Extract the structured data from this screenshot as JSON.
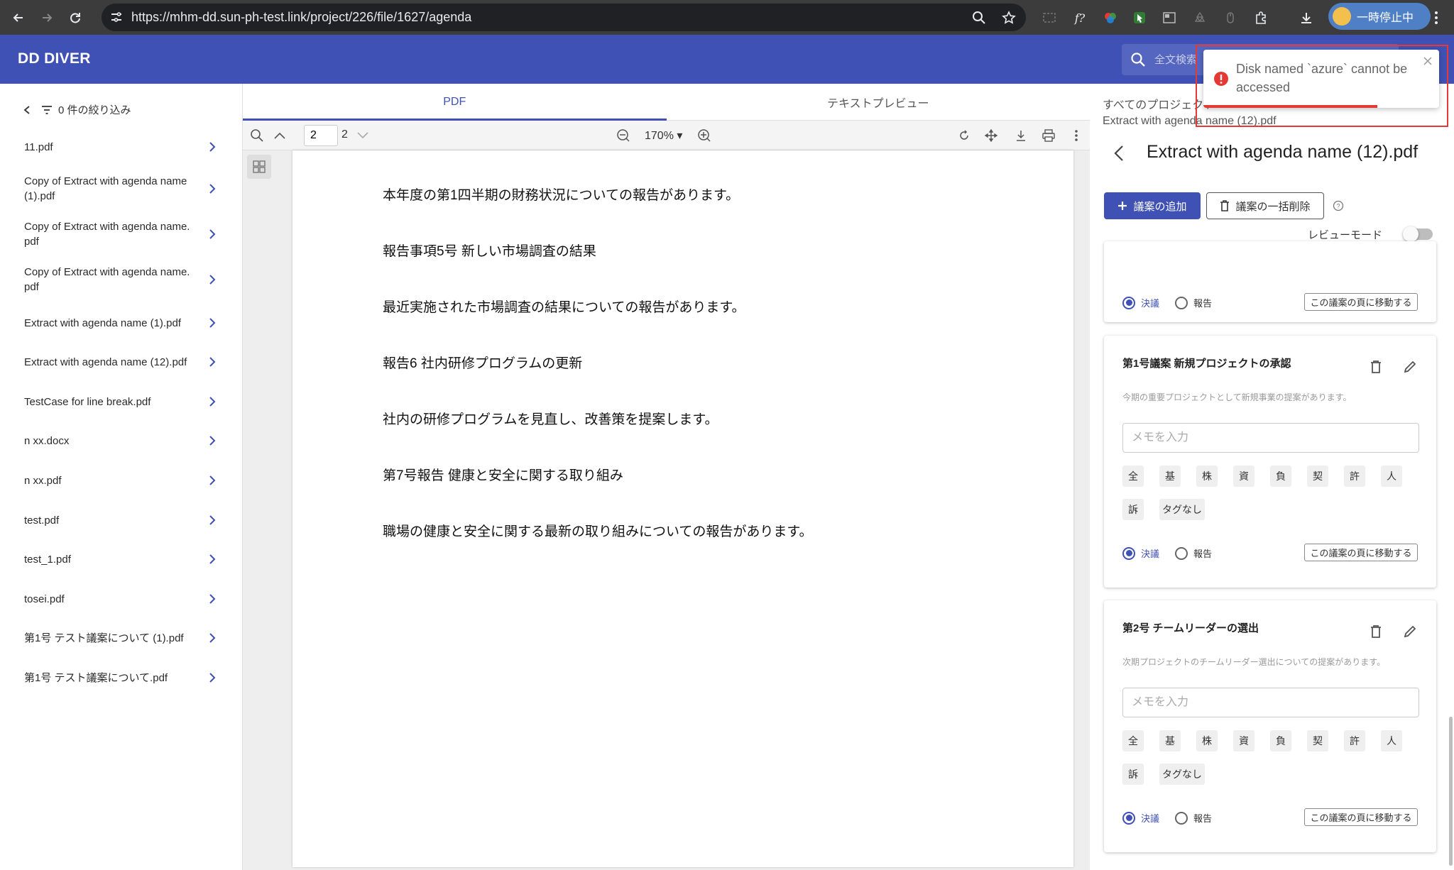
{
  "browser": {
    "url": "https://mhm-dd.sun-ph-test.link/project/226/file/1627/agenda",
    "profile_label": "一時停止中"
  },
  "app": {
    "brand": "DD DIVER",
    "search_placeholder": "全文検索",
    "accent": "#3f51b5"
  },
  "sidebar": {
    "filter_label": "0 件の絞り込み",
    "files": [
      "11.pdf",
      "Copy of Extract with agenda name (1).pdf",
      "Copy of Extract with agenda name.pdf",
      "Copy of Extract with agenda name.pdf",
      "Extract with agenda name (1).pdf",
      "Extract with agenda name (12).pdf",
      "TestCase for line break.pdf",
      "n xx.docx",
      "n xx.pdf",
      "test.pdf",
      "test_1.pdf",
      "tosei.pdf",
      "第1号 テスト議案について (1).pdf",
      "第1号 テスト議案について.pdf"
    ]
  },
  "viewer": {
    "tabs": [
      "PDF",
      "テキストプレビュー"
    ],
    "active_tab": "PDF",
    "page_number": "2",
    "page_total": "2",
    "zoom": "170%",
    "lines": [
      "本年度の第1四半期の財務状況についての報告があります。",
      "報告事項5号 新しい市場調査の結果",
      "最近実施された市場調査の結果についての報告があります。",
      "報告6  社内研修プログラムの更新",
      "社内の研修プログラムを見直し、改善策を提案します。",
      "第7号報告 健康と安全に関する取り組み",
      "職場の健康と安全に関する最新の取り組みについての報告があります。"
    ]
  },
  "panel": {
    "breadcrumb_root": "すべてのプロジェクト",
    "breadcrumb_file": "Extract with agenda name (12).pdf",
    "title": "Extract with agenda name (12).pdf",
    "add_button": "議案の追加",
    "bulk_delete_button": "議案の一括削除",
    "review_mode_label": "レビューモード",
    "radio_resolution": "決議",
    "radio_report": "報告",
    "goto_button": "この議案の頁に移動する",
    "memo_placeholder": "メモを入力",
    "tags": [
      "全",
      "基",
      "株",
      "資",
      "負",
      "契",
      "許",
      "人",
      "訴",
      "タグなし"
    ],
    "agendas": [
      {
        "title": "第1号議案 新規プロジェクトの承認",
        "description": "今期の重要プロジェクトとして新規事業の提案があります。"
      },
      {
        "title": "第2号 チームリーダーの選出",
        "description": "次期プロジェクトのチームリーダー選出についての提案があります。"
      }
    ]
  },
  "toast": {
    "message": "Disk named `azure` cannot be accessed",
    "color": "#e53935"
  }
}
